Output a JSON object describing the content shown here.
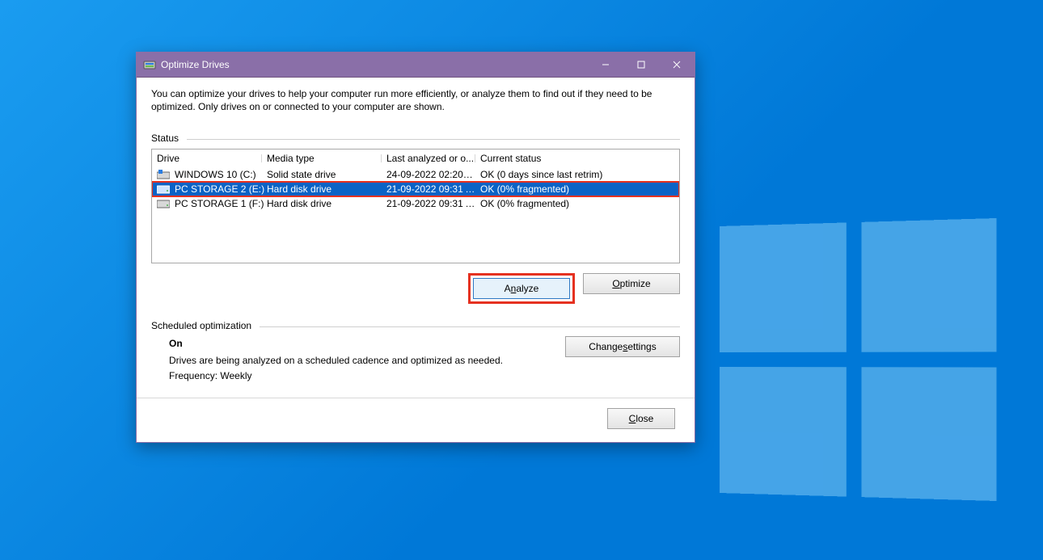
{
  "window": {
    "title": "Optimize Drives",
    "intro": "You can optimize your drives to help your computer run more efficiently, or analyze them to find out if they need to be optimized. Only drives on or connected to your computer are shown."
  },
  "status": {
    "heading": "Status",
    "columns": {
      "drive": "Drive",
      "media": "Media type",
      "last": "Last analyzed or o...",
      "status": "Current status"
    },
    "rows": [
      {
        "name": "WINDOWS 10 (C:)",
        "media": "Solid state drive",
        "last": "24-09-2022 02:20 P...",
        "status": "OK (0 days since last retrim)",
        "selected": false,
        "icon": "os"
      },
      {
        "name": "PC STORAGE 2 (E:)",
        "media": "Hard disk drive",
        "last": "21-09-2022 09:31 A...",
        "status": "OK (0% fragmented)",
        "selected": true,
        "icon": "hdd"
      },
      {
        "name": "PC STORAGE 1 (F:)",
        "media": "Hard disk drive",
        "last": "21-09-2022 09:31 A...",
        "status": "OK (0% fragmented)",
        "selected": false,
        "icon": "hdd"
      }
    ]
  },
  "buttons": {
    "analyze_pre": "A",
    "analyze_ul": "n",
    "analyze_post": "alyze",
    "optimize_pre": "",
    "optimize_ul": "O",
    "optimize_post": "ptimize",
    "change_pre": "Change ",
    "change_ul": "s",
    "change_post": "ettings",
    "close_pre": "",
    "close_ul": "C",
    "close_post": "lose"
  },
  "scheduled": {
    "heading": "Scheduled optimization",
    "state": "On",
    "desc": "Drives are being analyzed on a scheduled cadence and optimized as needed.",
    "freq": "Frequency: Weekly"
  }
}
